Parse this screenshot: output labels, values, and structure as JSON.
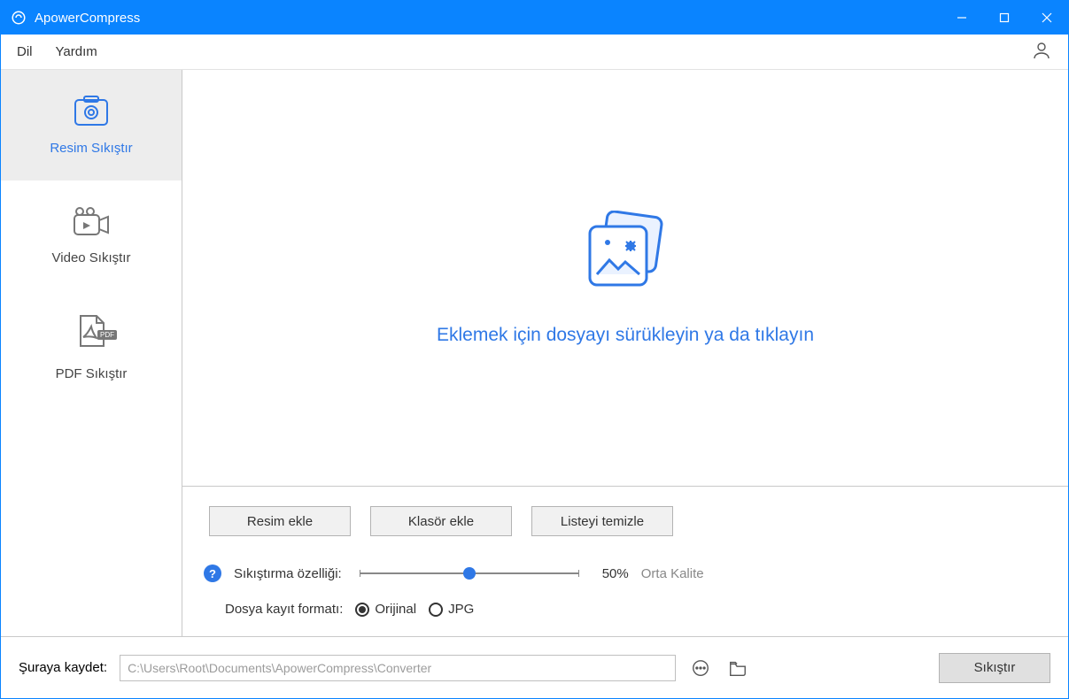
{
  "window": {
    "title": "ApowerCompress"
  },
  "menubar": {
    "items": [
      "Dil",
      "Yardım"
    ]
  },
  "sidebar": {
    "items": [
      {
        "label": "Resim Sıkıştır",
        "active": true
      },
      {
        "label": "Video Sıkıştır",
        "active": false
      },
      {
        "label": "PDF Sıkıştır",
        "active": false
      }
    ]
  },
  "content": {
    "drop_text": "Eklemek için dosyayı sürükleyin ya da tıklayın",
    "buttons": {
      "add_image": "Resim ekle",
      "add_folder": "Klasör ekle",
      "clear_list": "Listeyi temizle"
    },
    "quality": {
      "label": "Sıkıştırma özelliği:",
      "percent": "50%",
      "quality_label": "Orta Kalite",
      "value": 50
    },
    "format": {
      "label": "Dosya kayıt formatı:",
      "options": [
        "Orijinal",
        "JPG"
      ],
      "selected": "Orijinal"
    }
  },
  "bottom": {
    "save_to_label": "Şuraya kaydet:",
    "path": "C:\\Users\\Root\\Documents\\ApowerCompress\\Converter",
    "compress_label": "Sıkıştır"
  }
}
